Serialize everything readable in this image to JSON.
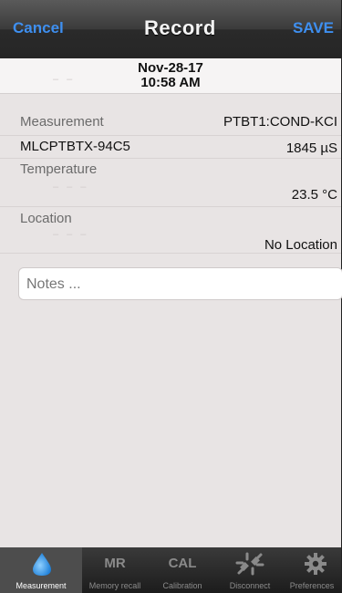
{
  "nav": {
    "cancel_label": "Cancel",
    "title": "Record",
    "save_label": "SAVE"
  },
  "date_header": {
    "date": "Nov-28-17",
    "time": "10:58 AM"
  },
  "measurement": {
    "label": "Measurement",
    "method": "PTBT1:COND-KCI",
    "device": "MLCPTBTX-94C5",
    "value": "1845 µS"
  },
  "temperature": {
    "label": "Temperature",
    "value": "23.5 °C"
  },
  "location": {
    "label": "Location",
    "value": "No Location"
  },
  "notes": {
    "placeholder": "Notes ..."
  },
  "tabs": [
    {
      "label": "Measurement",
      "icon": "water-drop-icon",
      "active": true
    },
    {
      "label": "Memory recall",
      "icon_text": "MR"
    },
    {
      "label": "Calibration",
      "icon_text": "CAL"
    },
    {
      "label": "Disconnect",
      "icon": "disconnect-icon"
    },
    {
      "label": "Preferences",
      "icon": "gear-icon"
    }
  ],
  "colors": {
    "accent": "#3e8ff0",
    "nav_bar": "#2f2f2f",
    "background": "#e8e4e4"
  }
}
